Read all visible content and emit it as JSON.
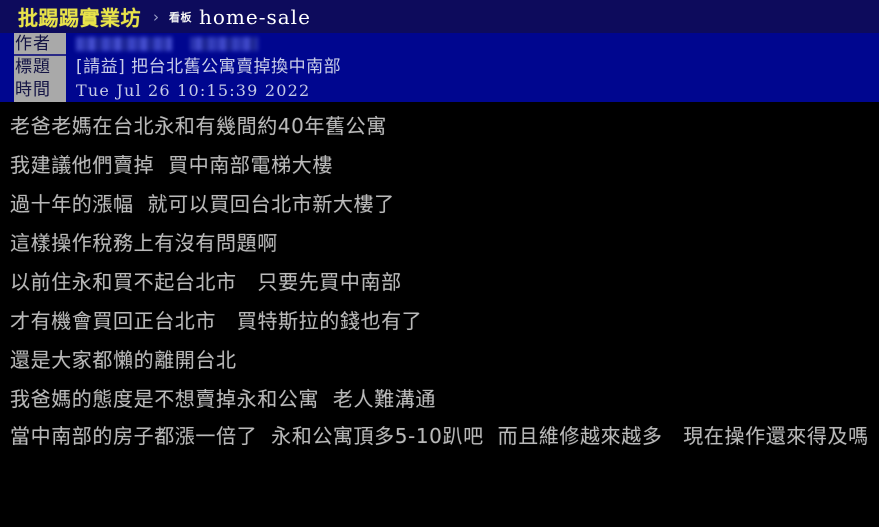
{
  "navbar": {
    "site_name": "批踢踢實業坊",
    "separator": "›",
    "board_label": "看板",
    "board_name": "home-sale",
    "site_color": "#e8e34a",
    "background_color": "#0d0b5c"
  },
  "meta": {
    "background_color": "#00068f",
    "label_background_color": "#a9a9a9",
    "author": {
      "label": "作者",
      "value_censored": true
    },
    "title": {
      "label": "標題",
      "value": "[請益] 把台北舊公寓賣掉換中南部"
    },
    "time": {
      "label": "時間",
      "value": "Tue Jul 26 10:15:39 2022"
    }
  },
  "post": {
    "text_color": "#b9b9b9",
    "background_color": "#000000",
    "paragraphs": [
      "老爸老媽在台北永和有幾間約40年舊公寓",
      "我建議他們賣掉  買中南部電梯大樓",
      "過十年的漲幅  就可以買回台北市新大樓了",
      "這樣操作稅務上有沒有問題啊",
      "以前住永和買不起台北市   只要先買中南部",
      "才有機會買回正台北市   買特斯拉的錢也有了",
      "還是大家都懶的離開台北",
      "我爸媽的態度是不想賣掉永和公寓  老人難溝通",
      "當中南部的房子都漲一倍了  永和公寓頂多5-10趴吧  而且維修越來越多   現在操作還來得及嗎"
    ]
  }
}
